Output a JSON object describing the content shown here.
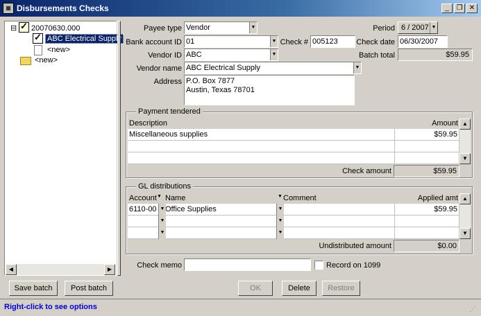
{
  "window": {
    "title": "Disbursements Checks",
    "minimize": "_",
    "restore": "❐",
    "close": "✕"
  },
  "tree": {
    "root_label": "20070630.000",
    "child_selected": "ABC Electrical Supply",
    "child_new": "<new>",
    "root_new": "<new>"
  },
  "left_buttons": {
    "save": "Save batch",
    "post": "Post batch"
  },
  "form": {
    "payee_type_label": "Payee type",
    "payee_type": "Vendor",
    "bank_account_label": "Bank account ID",
    "bank_account": "01",
    "check_no_label": "Check #",
    "check_no": "005123",
    "vendor_id_label": "Vendor ID",
    "vendor_id": "ABC",
    "vendor_name_label": "Vendor name",
    "vendor_name": "ABC Electrical Supply",
    "address_label": "Address",
    "address_line1": "P.O. Box 7877",
    "address_line2": "Austin, Texas  78701",
    "period_label": "Period",
    "period": "6 / 2007",
    "check_date_label": "Check date",
    "check_date": "06/30/2007",
    "batch_total_label": "Batch total",
    "batch_total": "$59.95"
  },
  "payment": {
    "title": "Payment tendered",
    "col_description": "Description",
    "col_amount": "Amount",
    "rows": [
      {
        "description": "Miscellaneous supplies",
        "amount": "$59.95"
      }
    ],
    "check_amount_label": "Check amount",
    "check_amount": "$59.95"
  },
  "gl": {
    "title": "GL distributions",
    "col_account": "Account",
    "col_name": "Name",
    "col_comment": "Comment",
    "col_applied": "Applied amt",
    "rows": [
      {
        "account": "6110-00",
        "name": "Office Supplies",
        "comment": "",
        "applied": "$59.95"
      }
    ],
    "undistributed_label": "Undistributed amount",
    "undistributed": "$0.00"
  },
  "memo": {
    "label": "Check memo",
    "value": "",
    "record_1099_label": "Record on 1099"
  },
  "actions": {
    "ok": "OK",
    "delete": "Delete",
    "restore": "Restore"
  },
  "status": "Right-click to see options"
}
